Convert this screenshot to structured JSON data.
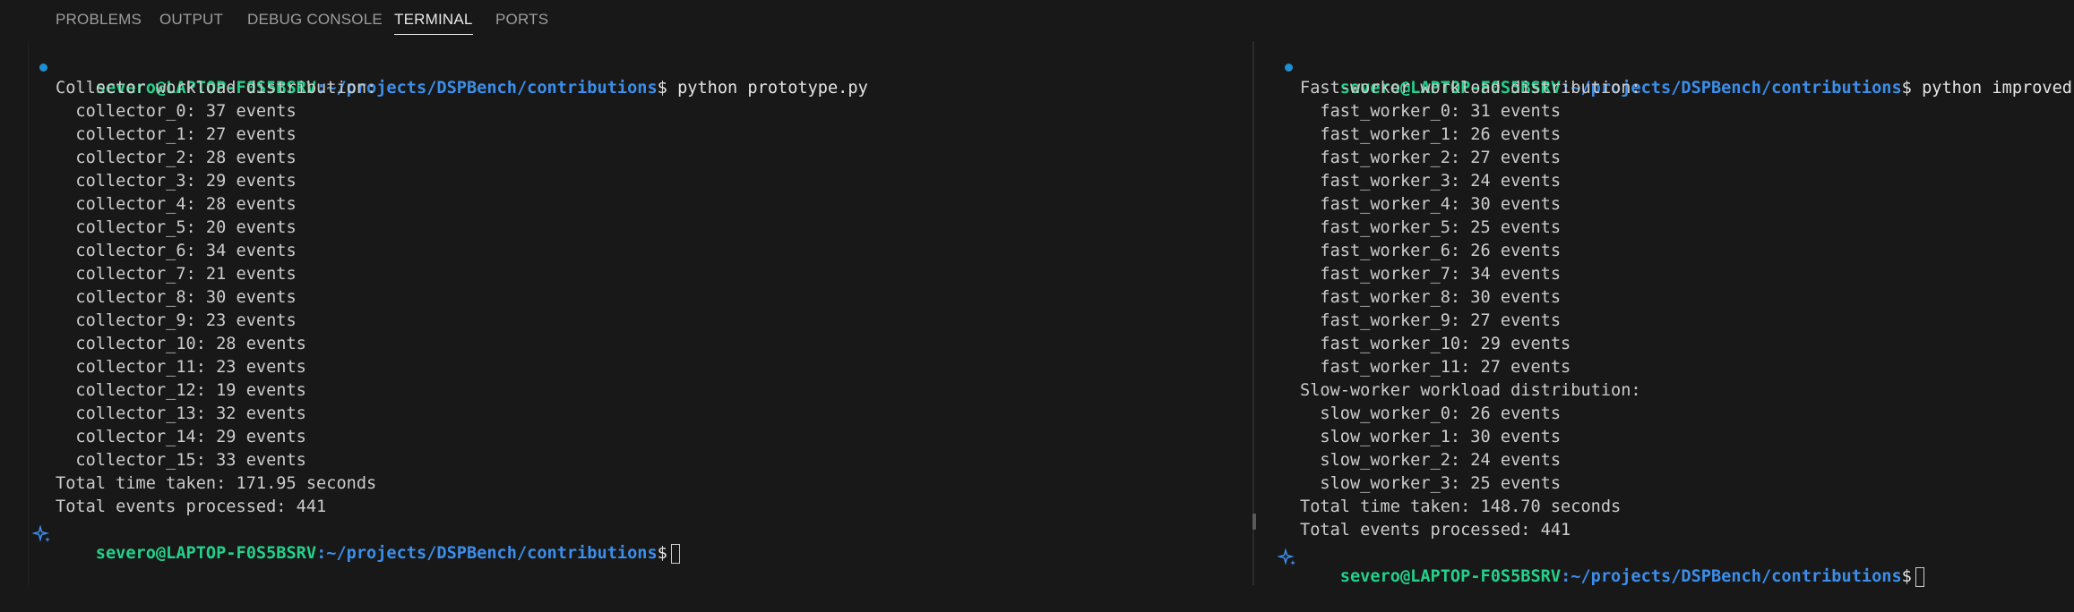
{
  "panel_tabs": [
    "PROBLEMS",
    "OUTPUT",
    "DEBUG CONSOLE",
    "TERMINAL",
    "PORTS"
  ],
  "active_tab": "TERMINAL",
  "colors": {
    "background": "#181818",
    "prompt_user": "#23d18b",
    "prompt_path": "#3b8eea",
    "text": "#cccccc",
    "status_dot": "#1e8fd0"
  },
  "left_terminal": {
    "prompt_user_host": "severo@LAPTOP-F0S5BSRV",
    "prompt_path": ":~/projects/DSPBench/contributions",
    "prompt_symbol": "$",
    "command": " python prototype.py",
    "output": [
      "Collector workload distribution:",
      "  collector_0: 37 events",
      "  collector_1: 27 events",
      "  collector_2: 28 events",
      "  collector_3: 29 events",
      "  collector_4: 28 events",
      "  collector_5: 20 events",
      "  collector_6: 34 events",
      "  collector_7: 21 events",
      "  collector_8: 30 events",
      "  collector_9: 23 events",
      "  collector_10: 28 events",
      "  collector_11: 23 events",
      "  collector_12: 19 events",
      "  collector_13: 32 events",
      "  collector_14: 29 events",
      "  collector_15: 33 events",
      "Total time taken: 171.95 seconds",
      "Total events processed: 441"
    ],
    "final_prompt_user_host": "severo@LAPTOP-F0S5BSRV",
    "final_prompt_path": ":~/projects/DSPBench/contributions",
    "final_prompt_symbol": "$"
  },
  "right_terminal": {
    "prompt_user_host": "severo@LAPTOP-F0S5BSRV",
    "prompt_path": ":~/projects/DSPBench/contributions",
    "prompt_symbol": "$",
    "command": " python improved.py",
    "output": [
      "Fast-worker workload distribution:",
      "  fast_worker_0: 31 events",
      "  fast_worker_1: 26 events",
      "  fast_worker_2: 27 events",
      "  fast_worker_3: 24 events",
      "  fast_worker_4: 30 events",
      "  fast_worker_5: 25 events",
      "  fast_worker_6: 26 events",
      "  fast_worker_7: 34 events",
      "  fast_worker_8: 30 events",
      "  fast_worker_9: 27 events",
      "  fast_worker_10: 29 events",
      "  fast_worker_11: 27 events",
      "Slow-worker workload distribution:",
      "  slow_worker_0: 26 events",
      "  slow_worker_1: 30 events",
      "  slow_worker_2: 24 events",
      "  slow_worker_3: 25 events",
      "Total time taken: 148.70 seconds",
      "Total events processed: 441"
    ],
    "final_prompt_user_host": "severo@LAPTOP-F0S5BSRV",
    "final_prompt_path": ":~/projects/DSPBench/contributions",
    "final_prompt_symbol": "$"
  }
}
